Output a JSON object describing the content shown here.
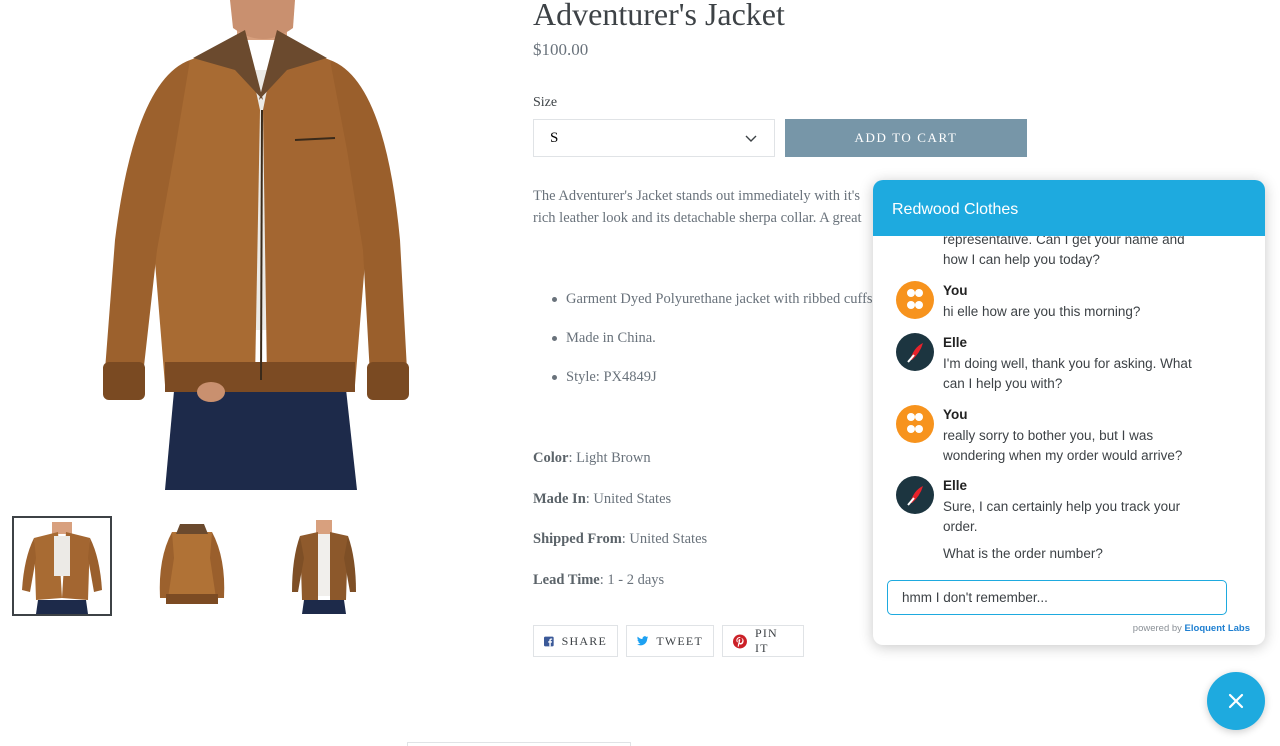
{
  "product": {
    "title": "Adventurer's Jacket",
    "price": "$100.00",
    "size_label": "Size",
    "size_selected": "S",
    "add_to_cart": "ADD TO CART",
    "description": "The Adventurer's Jacket stands out immediately with it's rich leather look and its detachable sherpa collar. A great piece for the Fall !",
    "bullets": [
      "Garment Dyed Polyurethane jacket with ribbed cuffs and hem.",
      " Made in China.",
      "Style: PX4849J"
    ],
    "attributes": [
      {
        "label": "Color",
        "value": ": Light Brown"
      },
      {
        "label": "Made In",
        "value": ": United States"
      },
      {
        "label": "Shipped From",
        "value": ": United States"
      },
      {
        "label": "Lead Time",
        "value": ": 1 - 2 days"
      }
    ],
    "share": {
      "facebook": "SHARE",
      "twitter": "TWEET",
      "pinterest": "PIN IT"
    }
  },
  "chat": {
    "header": "Redwood Clothes",
    "messages": [
      {
        "sender": "Elle",
        "lines": [
          "representative. Can I get your name and",
          "how I can help you today?"
        ]
      },
      {
        "sender": "You",
        "lines": [
          "hi elle how are you this morning?"
        ]
      },
      {
        "sender": "Elle",
        "lines": [
          "I'm doing well, thank you for asking. What",
          "can I help you with?"
        ]
      },
      {
        "sender": "You",
        "lines": [
          "really sorry to bother you, but I was",
          "wondering when my order would arrive?"
        ]
      },
      {
        "sender": "Elle",
        "lines": [
          "Sure, I can certainly help you track your",
          "order."
        ]
      },
      {
        "sender": "Elle",
        "lines": [
          "What is the order number?"
        ]
      }
    ],
    "input_value": "hmm I don't remember...",
    "powered_prefix": "powered by",
    "powered_brand": "Eloquent Labs"
  },
  "colors": {
    "chat_accent": "#1eaadf",
    "add_to_cart": "#7796a8",
    "you_avatar": "#f7931d",
    "elle_avatar": "#1c3540",
    "jacket": "#a86b33"
  }
}
